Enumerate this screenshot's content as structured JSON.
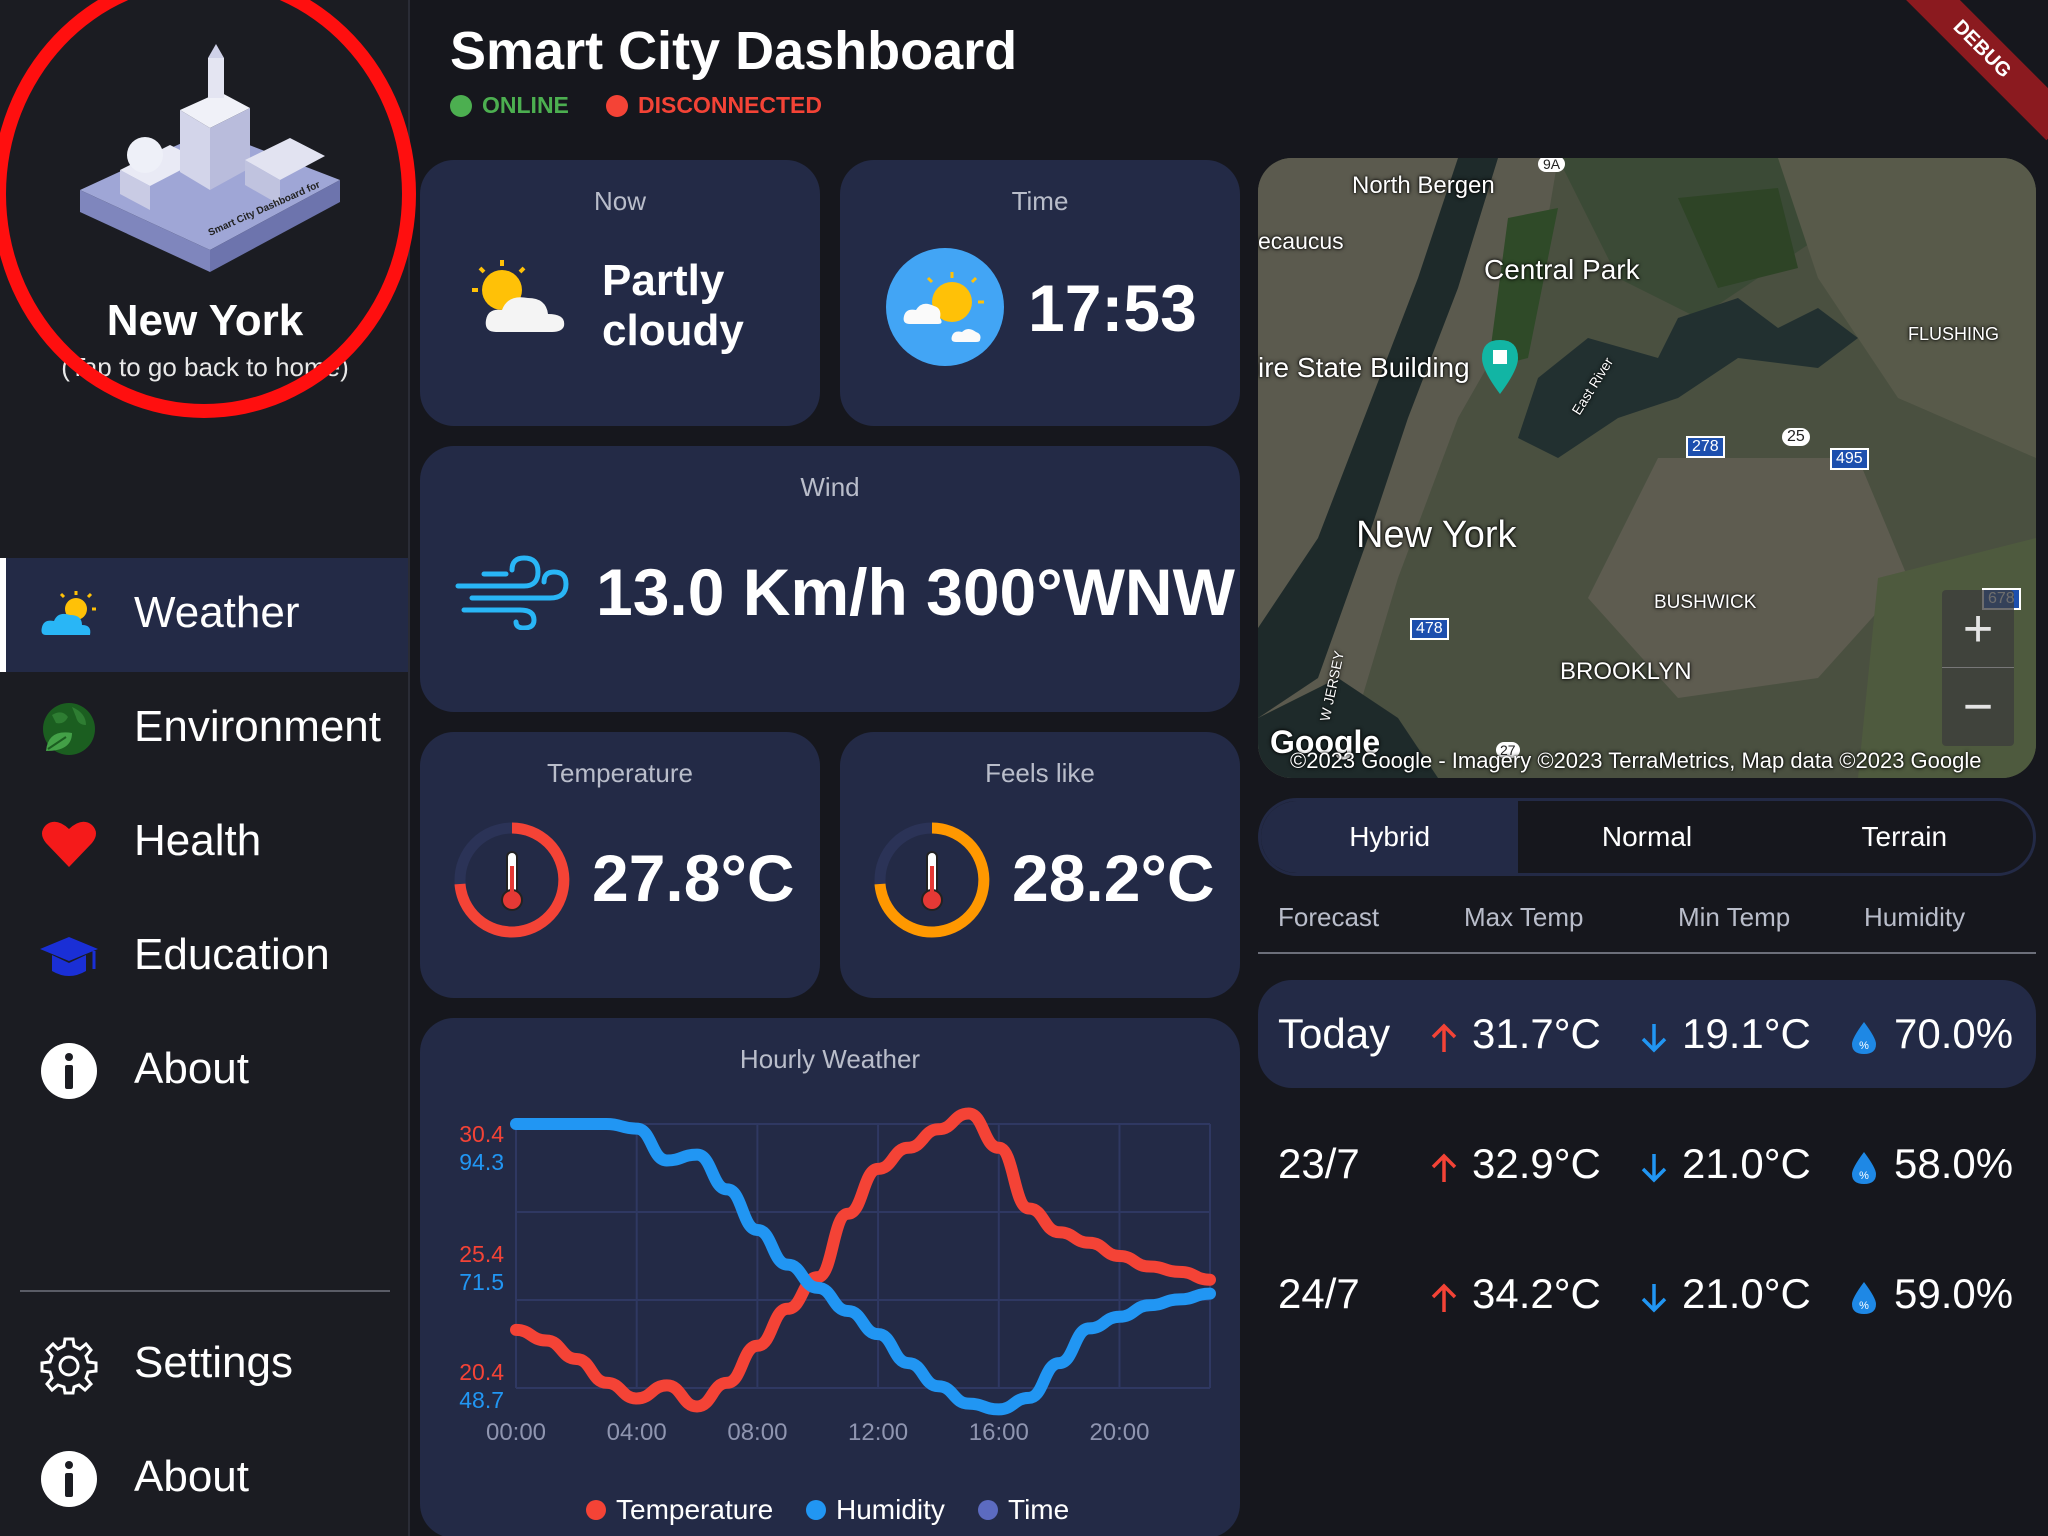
{
  "sidebar": {
    "city": "New York",
    "subtitle": "(Tap to go back to home)",
    "logo_text": "Smart City Dashboard for",
    "nav": [
      {
        "label": "Weather",
        "icon": "weather-icon"
      },
      {
        "label": "Environment",
        "icon": "globe-leaf-icon"
      },
      {
        "label": "Health",
        "icon": "heart-icon"
      },
      {
        "label": "Education",
        "icon": "graduation-cap-icon"
      },
      {
        "label": "About",
        "icon": "info-icon"
      }
    ],
    "bottom": [
      {
        "label": "Settings",
        "icon": "gear-icon"
      },
      {
        "label": "About",
        "icon": "info-icon"
      }
    ]
  },
  "header": {
    "title": "Smart City Dashboard",
    "status_online": "ONLINE",
    "status_disconnected": "DISCONNECTED",
    "debug": "DEBUG"
  },
  "cards": {
    "now": {
      "title": "Now",
      "value": "Partly cloudy"
    },
    "time": {
      "title": "Time",
      "value": "17:53"
    },
    "wind": {
      "title": "Wind",
      "value": "13.0 Km/h 300°WNW"
    },
    "temperature": {
      "title": "Temperature",
      "value": "27.8°C"
    },
    "feels_like": {
      "title": "Feels like",
      "value": "28.2°C"
    }
  },
  "map": {
    "labels": [
      "North Bergen",
      "ecaucus",
      "Central Park",
      "ire State Building",
      "FLUSHING",
      "New York",
      "BUSHWICK",
      "BROOKLYN",
      "East River",
      "W JERSEY",
      "9A",
      "278",
      "25",
      "495",
      "478",
      "678",
      "27"
    ],
    "attribution": "©2023 Google - Imagery ©2023 TerraMetrics, Map data ©2023 Google",
    "brand": "Google",
    "zoom_in": "+",
    "zoom_out": "−",
    "modes": [
      "Hybrid",
      "Normal",
      "Terrain"
    ],
    "active_mode": "Hybrid"
  },
  "forecast": {
    "headers": [
      "Forecast",
      "Max Temp",
      "Min Temp",
      "Humidity"
    ],
    "rows": [
      {
        "day": "Today",
        "max": "31.7°C",
        "min": "19.1°C",
        "humidity": "70.0%"
      },
      {
        "day": "23/7",
        "max": "32.9°C",
        "min": "21.0°C",
        "humidity": "58.0%"
      },
      {
        "day": "24/7",
        "max": "34.2°C",
        "min": "21.0°C",
        "humidity": "59.0%"
      }
    ]
  },
  "colors": {
    "temperature": "#f44336",
    "humidity": "#2196f3",
    "time": "#5c6bc0",
    "online": "#4caf50",
    "disconnected": "#f44336",
    "card": "#232a46"
  },
  "chart_data": {
    "type": "line",
    "title": "Hourly Weather",
    "x": [
      "00:00",
      "01:00",
      "02:00",
      "03:00",
      "04:00",
      "05:00",
      "06:00",
      "07:00",
      "08:00",
      "09:00",
      "10:00",
      "11:00",
      "12:00",
      "13:00",
      "14:00",
      "15:00",
      "16:00",
      "17:00",
      "18:00",
      "19:00",
      "20:00",
      "21:00",
      "22:00",
      "23:00"
    ],
    "xticks": [
      "00:00",
      "04:00",
      "08:00",
      "12:00",
      "16:00",
      "20:00"
    ],
    "series": [
      {
        "name": "Temperature",
        "ylim": [
          20.4,
          30.4
        ],
        "yticks": [
          "30.4",
          "25.4",
          "20.4"
        ],
        "values": [
          22.6,
          22.2,
          21.5,
          20.6,
          20.0,
          20.5,
          19.7,
          20.6,
          22.0,
          23.4,
          24.6,
          27.0,
          28.7,
          29.5,
          30.2,
          30.8,
          29.5,
          27.2,
          26.3,
          25.9,
          25.4,
          25.0,
          24.8,
          24.5
        ]
      },
      {
        "name": "Humidity",
        "ylim": [
          48.7,
          94.3
        ],
        "yticks": [
          "94.3",
          "71.5",
          "48.7"
        ],
        "values": [
          94.3,
          94.3,
          94.3,
          94.3,
          93.5,
          88.0,
          89.0,
          83.0,
          76.0,
          70.0,
          66.0,
          62.0,
          58.0,
          53.0,
          49.0,
          46.0,
          45.0,
          47.0,
          53.0,
          59.0,
          61.0,
          63.0,
          64.0,
          65.0
        ]
      }
    ],
    "legend": [
      "Temperature",
      "Humidity",
      "Time"
    ],
    "legend_position": "bottom",
    "grid": true
  }
}
